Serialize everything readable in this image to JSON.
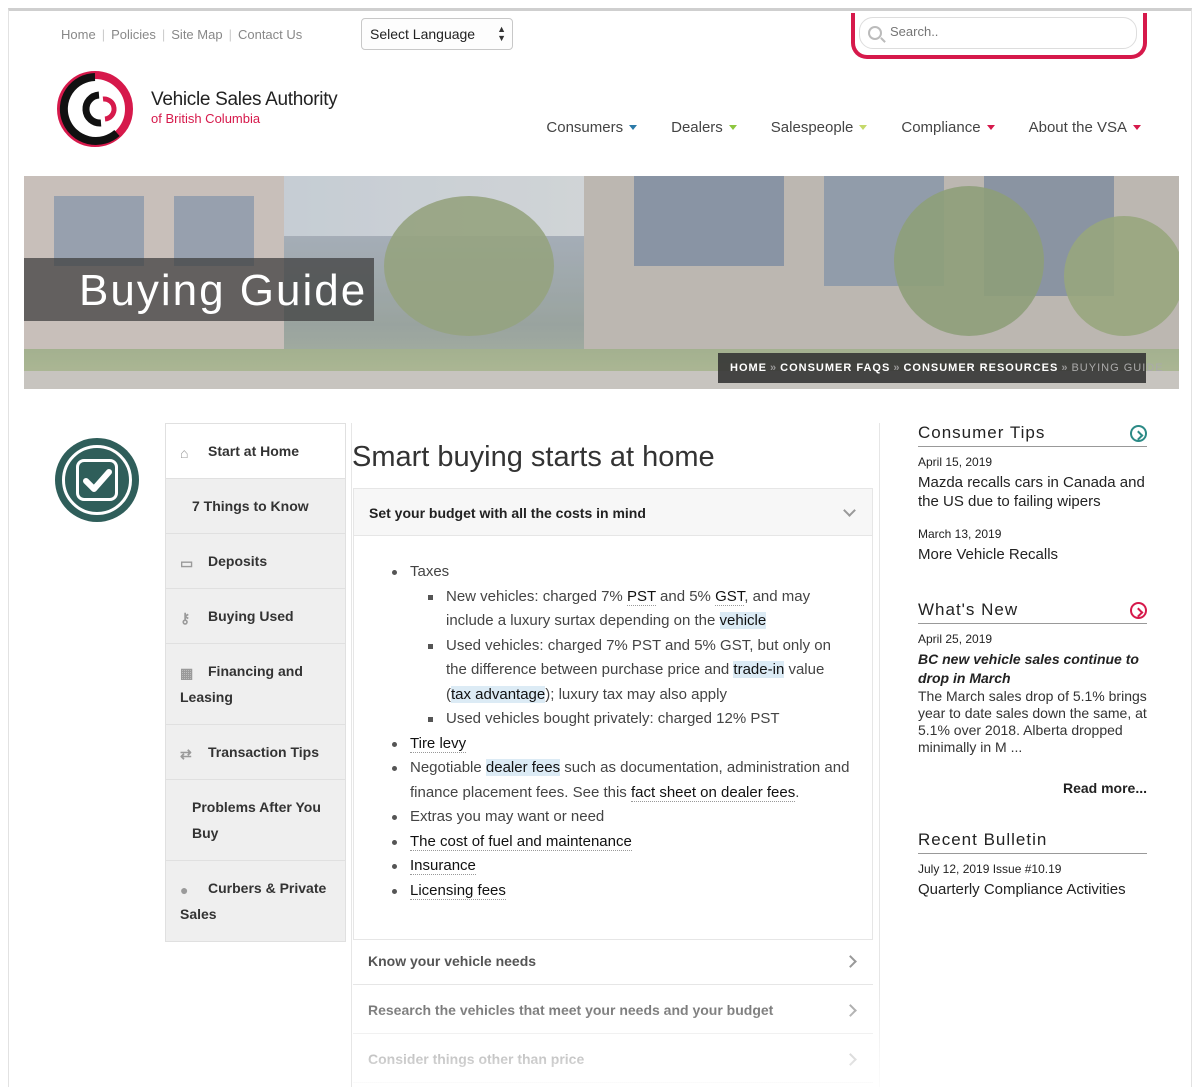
{
  "utility_nav": [
    "Home",
    "Policies",
    "Site Map",
    "Contact Us"
  ],
  "language_select": {
    "value": "Select Language"
  },
  "search": {
    "placeholder": "Search.."
  },
  "logo": {
    "name": "Vehicle Sales Authority",
    "sub": "of British Columbia"
  },
  "main_nav": [
    {
      "label": "Consumers",
      "color": "#2b7aa8"
    },
    {
      "label": "Dealers",
      "color": "#8dc63f"
    },
    {
      "label": "Salespeople",
      "color": "#c5d96a"
    },
    {
      "label": "Compliance",
      "color": "#d6194b"
    },
    {
      "label": "About the VSA",
      "color": "#d6194b"
    }
  ],
  "hero": {
    "title": "Buying Guide"
  },
  "breadcrumb": [
    "HOME",
    "CONSUMER FAQS",
    "CONSUMER RESOURCES",
    "BUYING GUIDE"
  ],
  "sidebar": [
    {
      "label": "Start at Home",
      "icon": "home-icon"
    },
    {
      "label": "7 Things to Know",
      "icon": ""
    },
    {
      "label": "Deposits",
      "icon": "inbox-icon"
    },
    {
      "label": "Buying Used",
      "icon": "key-icon"
    },
    {
      "label": "Financing and Leasing",
      "icon": "calculator-icon"
    },
    {
      "label": "Transaction Tips",
      "icon": "exchange-icon"
    },
    {
      "label": "Problems After You Buy",
      "icon": ""
    },
    {
      "label": "Curbers & Private Sales",
      "icon": "user-icon"
    }
  ],
  "main": {
    "title": "Smart buying starts at home",
    "accordion_open": "Set your budget with all the costs in mind",
    "taxes": "Taxes",
    "sub1a": "New vehicles: charged 7% ",
    "pst": "PST",
    "sub1b": " and 5% ",
    "gst": "GST",
    "sub1c": ", and may include a luxury surtax depending on the ",
    "vehicle": "vehicle",
    "sub2a": "Used vehicles: charged 7% PST and 5% GST, but only on the difference between purchase price and ",
    "tradein": "trade-in",
    "sub2b": " value (",
    "taxadv": "tax advantage",
    "sub2c": "); luxury tax may also apply",
    "sub3": "Used vehicles bought privately: charged 12% PST",
    "tirelevy": "Tire levy",
    "neg_a": "Negotiable ",
    "dealerfees": "dealer fees",
    "neg_b": " such as documentation, administration and finance placement fees. See this ",
    "factsheet": "fact sheet on dealer fees",
    "neg_c": ".",
    "extras": "Extras you may want or need",
    "fuel": "The cost of fuel and maintenance",
    "insurance": "Insurance",
    "licensing": "Licensing fees",
    "acc2": "Know your vehicle needs",
    "acc3": "Research the vehicles that meet your needs and your budget",
    "acc4": "Consider things other than price"
  },
  "right": {
    "tips_title": "Consumer Tips",
    "tip1_date": "April 15, 2019",
    "tip1_title": "Mazda recalls cars in Canada and the US due to failing wipers",
    "tip2_date": "March 13, 2019",
    "tip2_title": "More Vehicle Recalls",
    "new_title": "What's New",
    "new_date": "April 25, 2019",
    "new_headline": "BC new vehicle sales continue to drop in March",
    "new_excerpt": "The March sales drop of 5.1% brings year to date sales down the same, at 5.1% over 2018. Alberta dropped minimally in M ...",
    "read_more": "Read more...",
    "bulletin_title": "Recent Bulletin",
    "bulletin_date": "July 12, 2019 Issue #10.19",
    "bulletin_item": "Quarterly Compliance Activities"
  }
}
